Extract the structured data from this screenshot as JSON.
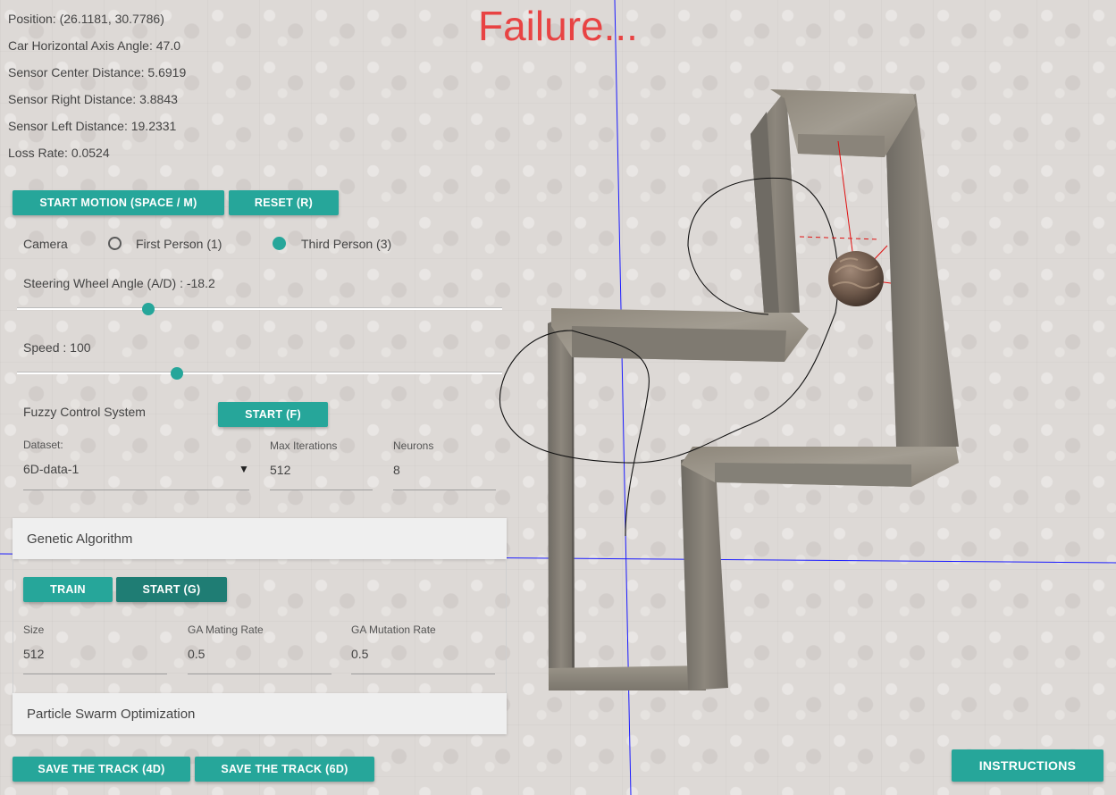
{
  "status": {
    "position": "Position: (26.1181, 30.7786)",
    "car_angle": "Car Horizontal Axis Angle: 47.0",
    "sensor_center": "Sensor Center Distance: 5.6919",
    "sensor_right": "Sensor Right Distance: 3.8843",
    "sensor_left": "Sensor Left Distance: 19.2331",
    "loss_rate": "Loss Rate: 0.0524"
  },
  "result_text": "Failure...",
  "controls": {
    "start_motion_label": "START MOTION (SPACE / M)",
    "reset_label": "RESET (R)",
    "camera_label": "Camera",
    "first_person_label": "First Person (1)",
    "third_person_label": "Third Person (3)",
    "camera_selected": "third",
    "steering_label": "Steering Wheel Angle (A/D) : -18.2",
    "steering_fraction": 0.27,
    "speed_label": "Speed : 100",
    "speed_fraction": 0.33
  },
  "fuzzy": {
    "title": "Fuzzy Control System",
    "start_label": "START (F)",
    "dataset_label": "Dataset:",
    "dataset_value": "6D-data-1",
    "max_iter_label": "Max Iterations",
    "max_iter_value": "512",
    "neurons_label": "Neurons",
    "neurons_value": "8"
  },
  "genetic": {
    "title": "Genetic Algorithm",
    "train_label": "TRAIN",
    "start_label": "START (G)",
    "size_label": "Size",
    "size_value": "512",
    "mating_label": "GA Mating Rate",
    "mating_value": "0.5",
    "mutation_label": "GA Mutation Rate",
    "mutation_value": "0.5"
  },
  "pso": {
    "title": "Particle Swarm Optimization"
  },
  "footer": {
    "save_4d_label": "SAVE THE TRACK (4D)",
    "save_6d_label": "SAVE THE TRACK (6D)",
    "instructions_label": "INSTRUCTIONS"
  },
  "colors": {
    "accent": "#26a69a",
    "accent_dark": "#1f7d74",
    "failure": "#e84343",
    "axis": "#1a1aff",
    "sensor_ray": "#e01010"
  }
}
